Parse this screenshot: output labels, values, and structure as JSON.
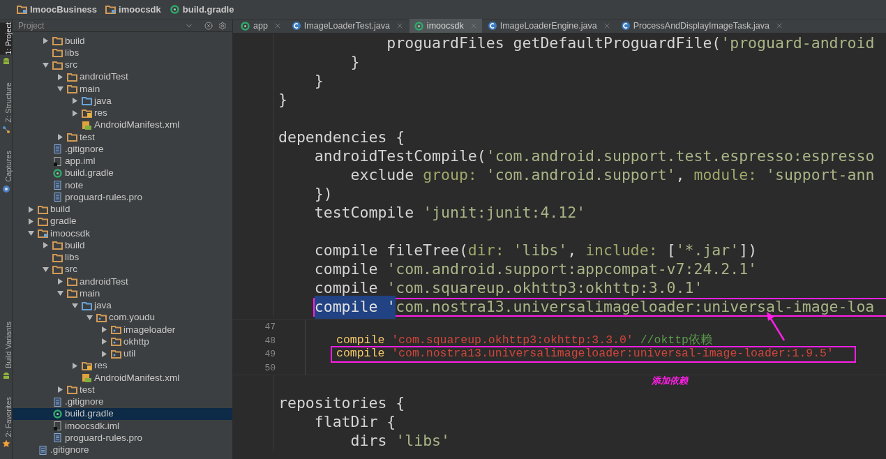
{
  "breadcrumb": [
    {
      "label": "ImoocBusiness",
      "kind": "module"
    },
    {
      "label": "imoocsdk",
      "kind": "module"
    },
    {
      "label": "build.gradle",
      "kind": "gradle"
    }
  ],
  "tool_strip": {
    "top": [
      {
        "label": "1: Project",
        "kind": "android",
        "selected": true
      },
      {
        "label": "Z: Structure",
        "kind": "structure",
        "selected": false
      },
      {
        "label": "Captures",
        "kind": "capture",
        "selected": false
      }
    ],
    "bottom": [
      {
        "label": "Build Variants",
        "kind": "android",
        "selected": false
      },
      {
        "label": "2: Favorites",
        "kind": "star",
        "selected": false
      }
    ]
  },
  "project_panel": {
    "title": "Project",
    "continued_children": [
      {
        "label": "build",
        "kind": "folder",
        "expanded": false,
        "selected": false
      },
      {
        "label": "libs",
        "kind": "folder",
        "selected": false
      },
      {
        "label": "src",
        "kind": "folder",
        "expanded": true,
        "selected": false,
        "children": [
          {
            "label": "androidTest",
            "kind": "folder",
            "expanded": false,
            "selected": false
          },
          {
            "label": "main",
            "kind": "folder",
            "expanded": true,
            "selected": false,
            "children": [
              {
                "label": "java",
                "kind": "source",
                "expanded": false,
                "selected": false
              },
              {
                "label": "res",
                "kind": "resource",
                "expanded": false,
                "selected": false
              },
              {
                "label": "AndroidManifest.xml",
                "kind": "manifest",
                "selected": false
              }
            ]
          },
          {
            "label": "test",
            "kind": "folder",
            "expanded": false,
            "selected": false
          }
        ]
      },
      {
        "label": ".gitignore",
        "kind": "text",
        "selected": false
      },
      {
        "label": "app.iml",
        "kind": "iml",
        "selected": false
      },
      {
        "label": "build.gradle",
        "kind": "gradle",
        "selected": false
      },
      {
        "label": "note",
        "kind": "text",
        "selected": false
      },
      {
        "label": "proguard-rules.pro",
        "kind": "text",
        "selected": false
      }
    ],
    "items": [
      {
        "label": "build",
        "kind": "folder",
        "expanded": false,
        "selected": false
      },
      {
        "label": "gradle",
        "kind": "folder",
        "expanded": false,
        "selected": false
      },
      {
        "label": "imoocsdk",
        "kind": "module",
        "expanded": true,
        "selected": false,
        "children": [
          {
            "label": "build",
            "kind": "folder",
            "expanded": false,
            "selected": false
          },
          {
            "label": "libs",
            "kind": "folder",
            "selected": false
          },
          {
            "label": "src",
            "kind": "folder",
            "expanded": true,
            "selected": false,
            "children": [
              {
                "label": "androidTest",
                "kind": "folder",
                "expanded": false,
                "selected": false
              },
              {
                "label": "main",
                "kind": "folder",
                "expanded": true,
                "selected": false,
                "children": [
                  {
                    "label": "java",
                    "kind": "source",
                    "expanded": true,
                    "selected": false,
                    "children": [
                      {
                        "label": "com.youdu",
                        "kind": "package",
                        "expanded": true,
                        "selected": false,
                        "children": [
                          {
                            "label": "imageloader",
                            "kind": "package",
                            "expanded": false,
                            "selected": false
                          },
                          {
                            "label": "okhttp",
                            "kind": "package",
                            "expanded": false,
                            "selected": false
                          },
                          {
                            "label": "util",
                            "kind": "package",
                            "expanded": false,
                            "selected": false
                          }
                        ]
                      }
                    ]
                  },
                  {
                    "label": "res",
                    "kind": "resource",
                    "expanded": false,
                    "selected": false
                  },
                  {
                    "label": "AndroidManifest.xml",
                    "kind": "manifest",
                    "selected": false
                  }
                ]
              },
              {
                "label": "test",
                "kind": "folder",
                "expanded": false,
                "selected": false
              }
            ]
          },
          {
            "label": ".gitignore",
            "kind": "text",
            "selected": false
          },
          {
            "label": "build.gradle",
            "kind": "gradle",
            "selected": true
          },
          {
            "label": "imoocsdk.iml",
            "kind": "iml",
            "selected": false
          },
          {
            "label": "proguard-rules.pro",
            "kind": "text",
            "selected": false
          }
        ]
      },
      {
        "label": ".gitignore",
        "kind": "text",
        "selected": false
      }
    ]
  },
  "tabs": [
    {
      "label": "app",
      "kind": "gradle",
      "selected": false
    },
    {
      "label": "ImageLoaderTest.java",
      "kind": "class",
      "selected": false
    },
    {
      "label": "imoocsdk",
      "kind": "gradle",
      "selected": true
    },
    {
      "label": "ImageLoaderEngine.java",
      "kind": "class",
      "selected": false
    },
    {
      "label": "ProcessAndDisplayImageTask.java",
      "kind": "class",
      "selected": false
    }
  ],
  "editor": {
    "lines_above": [
      {
        "kind": "code",
        "boxed": false,
        "segments": [
          {
            "kind": "plain",
            "text": "            proguardFiles getDefaultProguardFile("
          },
          {
            "kind": "string",
            "text": "'proguard-android"
          }
        ]
      },
      {
        "kind": "code",
        "boxed": false,
        "segments": [
          {
            "kind": "plain",
            "text": "        }"
          }
        ]
      },
      {
        "kind": "code",
        "boxed": false,
        "segments": [
          {
            "kind": "plain",
            "text": "    }"
          }
        ]
      },
      {
        "kind": "code",
        "boxed": false,
        "segments": [
          {
            "kind": "plain",
            "text": "}"
          }
        ]
      },
      {
        "kind": "blank"
      },
      {
        "kind": "code",
        "boxed": false,
        "segments": [
          {
            "kind": "plain",
            "text": "dependencies {"
          }
        ]
      },
      {
        "kind": "code",
        "boxed": false,
        "segments": [
          {
            "kind": "plain",
            "text": "    androidTestCompile("
          },
          {
            "kind": "string",
            "text": "'com.android.support.test.espresso:espresso"
          }
        ]
      },
      {
        "kind": "code",
        "boxed": false,
        "segments": [
          {
            "kind": "plain",
            "text": "        exclude "
          },
          {
            "kind": "param",
            "text": "group: "
          },
          {
            "kind": "string",
            "text": "'com.android.support'"
          },
          {
            "kind": "plain",
            "text": ", "
          },
          {
            "kind": "param",
            "text": "module: "
          },
          {
            "kind": "string",
            "text": "'support-ann"
          }
        ]
      },
      {
        "kind": "code",
        "boxed": false,
        "segments": [
          {
            "kind": "plain",
            "text": "    })"
          }
        ]
      },
      {
        "kind": "code",
        "boxed": false,
        "segments": [
          {
            "kind": "plain",
            "text": "    testCompile "
          },
          {
            "kind": "string",
            "text": "'junit:junit:4.12'"
          }
        ]
      },
      {
        "kind": "blank"
      },
      {
        "kind": "code",
        "boxed": false,
        "segments": [
          {
            "kind": "plain",
            "text": "    compile fileTree("
          },
          {
            "kind": "param",
            "text": "dir: "
          },
          {
            "kind": "string",
            "text": "'libs'"
          },
          {
            "kind": "plain",
            "text": ", "
          },
          {
            "kind": "param",
            "text": "include:"
          },
          {
            "kind": "plain",
            "text": " ["
          },
          {
            "kind": "string",
            "text": "'*.jar'"
          },
          {
            "kind": "plain",
            "text": "])"
          }
        ]
      },
      {
        "kind": "code",
        "boxed": false,
        "segments": [
          {
            "kind": "plain",
            "text": "    compile "
          },
          {
            "kind": "string",
            "text": "'com.android.support:appcompat-v7:24.2.1'"
          }
        ]
      },
      {
        "kind": "code",
        "boxed": false,
        "segments": [
          {
            "kind": "plain",
            "text": "    compile "
          },
          {
            "kind": "string",
            "text": "'com.squareup.okhttp3:okhttp:3.0.1'"
          }
        ]
      },
      {
        "kind": "code",
        "boxed": true,
        "segments": [
          {
            "kind": "selection",
            "text": "    compile '"
          },
          {
            "kind": "string",
            "text": "com.nostra13.universalimageloader:universal-image-loa"
          }
        ]
      }
    ],
    "snippet": {
      "note": "添加依赖",
      "lines": [
        {
          "number": "47"
        },
        {
          "number": "48",
          "boxed": false,
          "segments": [
            {
              "kind": "keyword",
              "text": "compile "
            },
            {
              "kind": "string",
              "text": "'com.squareup.okhttp3:okhttp:3.3.0'"
            },
            {
              "kind": "comment",
              "text": " //okttp依赖"
            }
          ]
        },
        {
          "number": "49",
          "boxed": true,
          "segments": [
            {
              "kind": "keyword",
              "text": "compile "
            },
            {
              "kind": "string",
              "text": "'com.nostra13.universalimageloader:universal-image-loader:1.9.5'"
            }
          ]
        },
        {
          "number": "50"
        }
      ]
    },
    "lines_below": [
      {
        "kind": "blank"
      },
      {
        "kind": "code",
        "boxed": false,
        "segments": [
          {
            "kind": "plain",
            "text": "repositories {"
          }
        ]
      },
      {
        "kind": "code",
        "boxed": false,
        "segments": [
          {
            "kind": "plain",
            "text": "    flatDir {"
          }
        ]
      },
      {
        "kind": "code",
        "boxed": false,
        "segments": [
          {
            "kind": "plain",
            "text": "        dirs "
          },
          {
            "kind": "string",
            "text": "'libs'"
          }
        ]
      }
    ]
  }
}
